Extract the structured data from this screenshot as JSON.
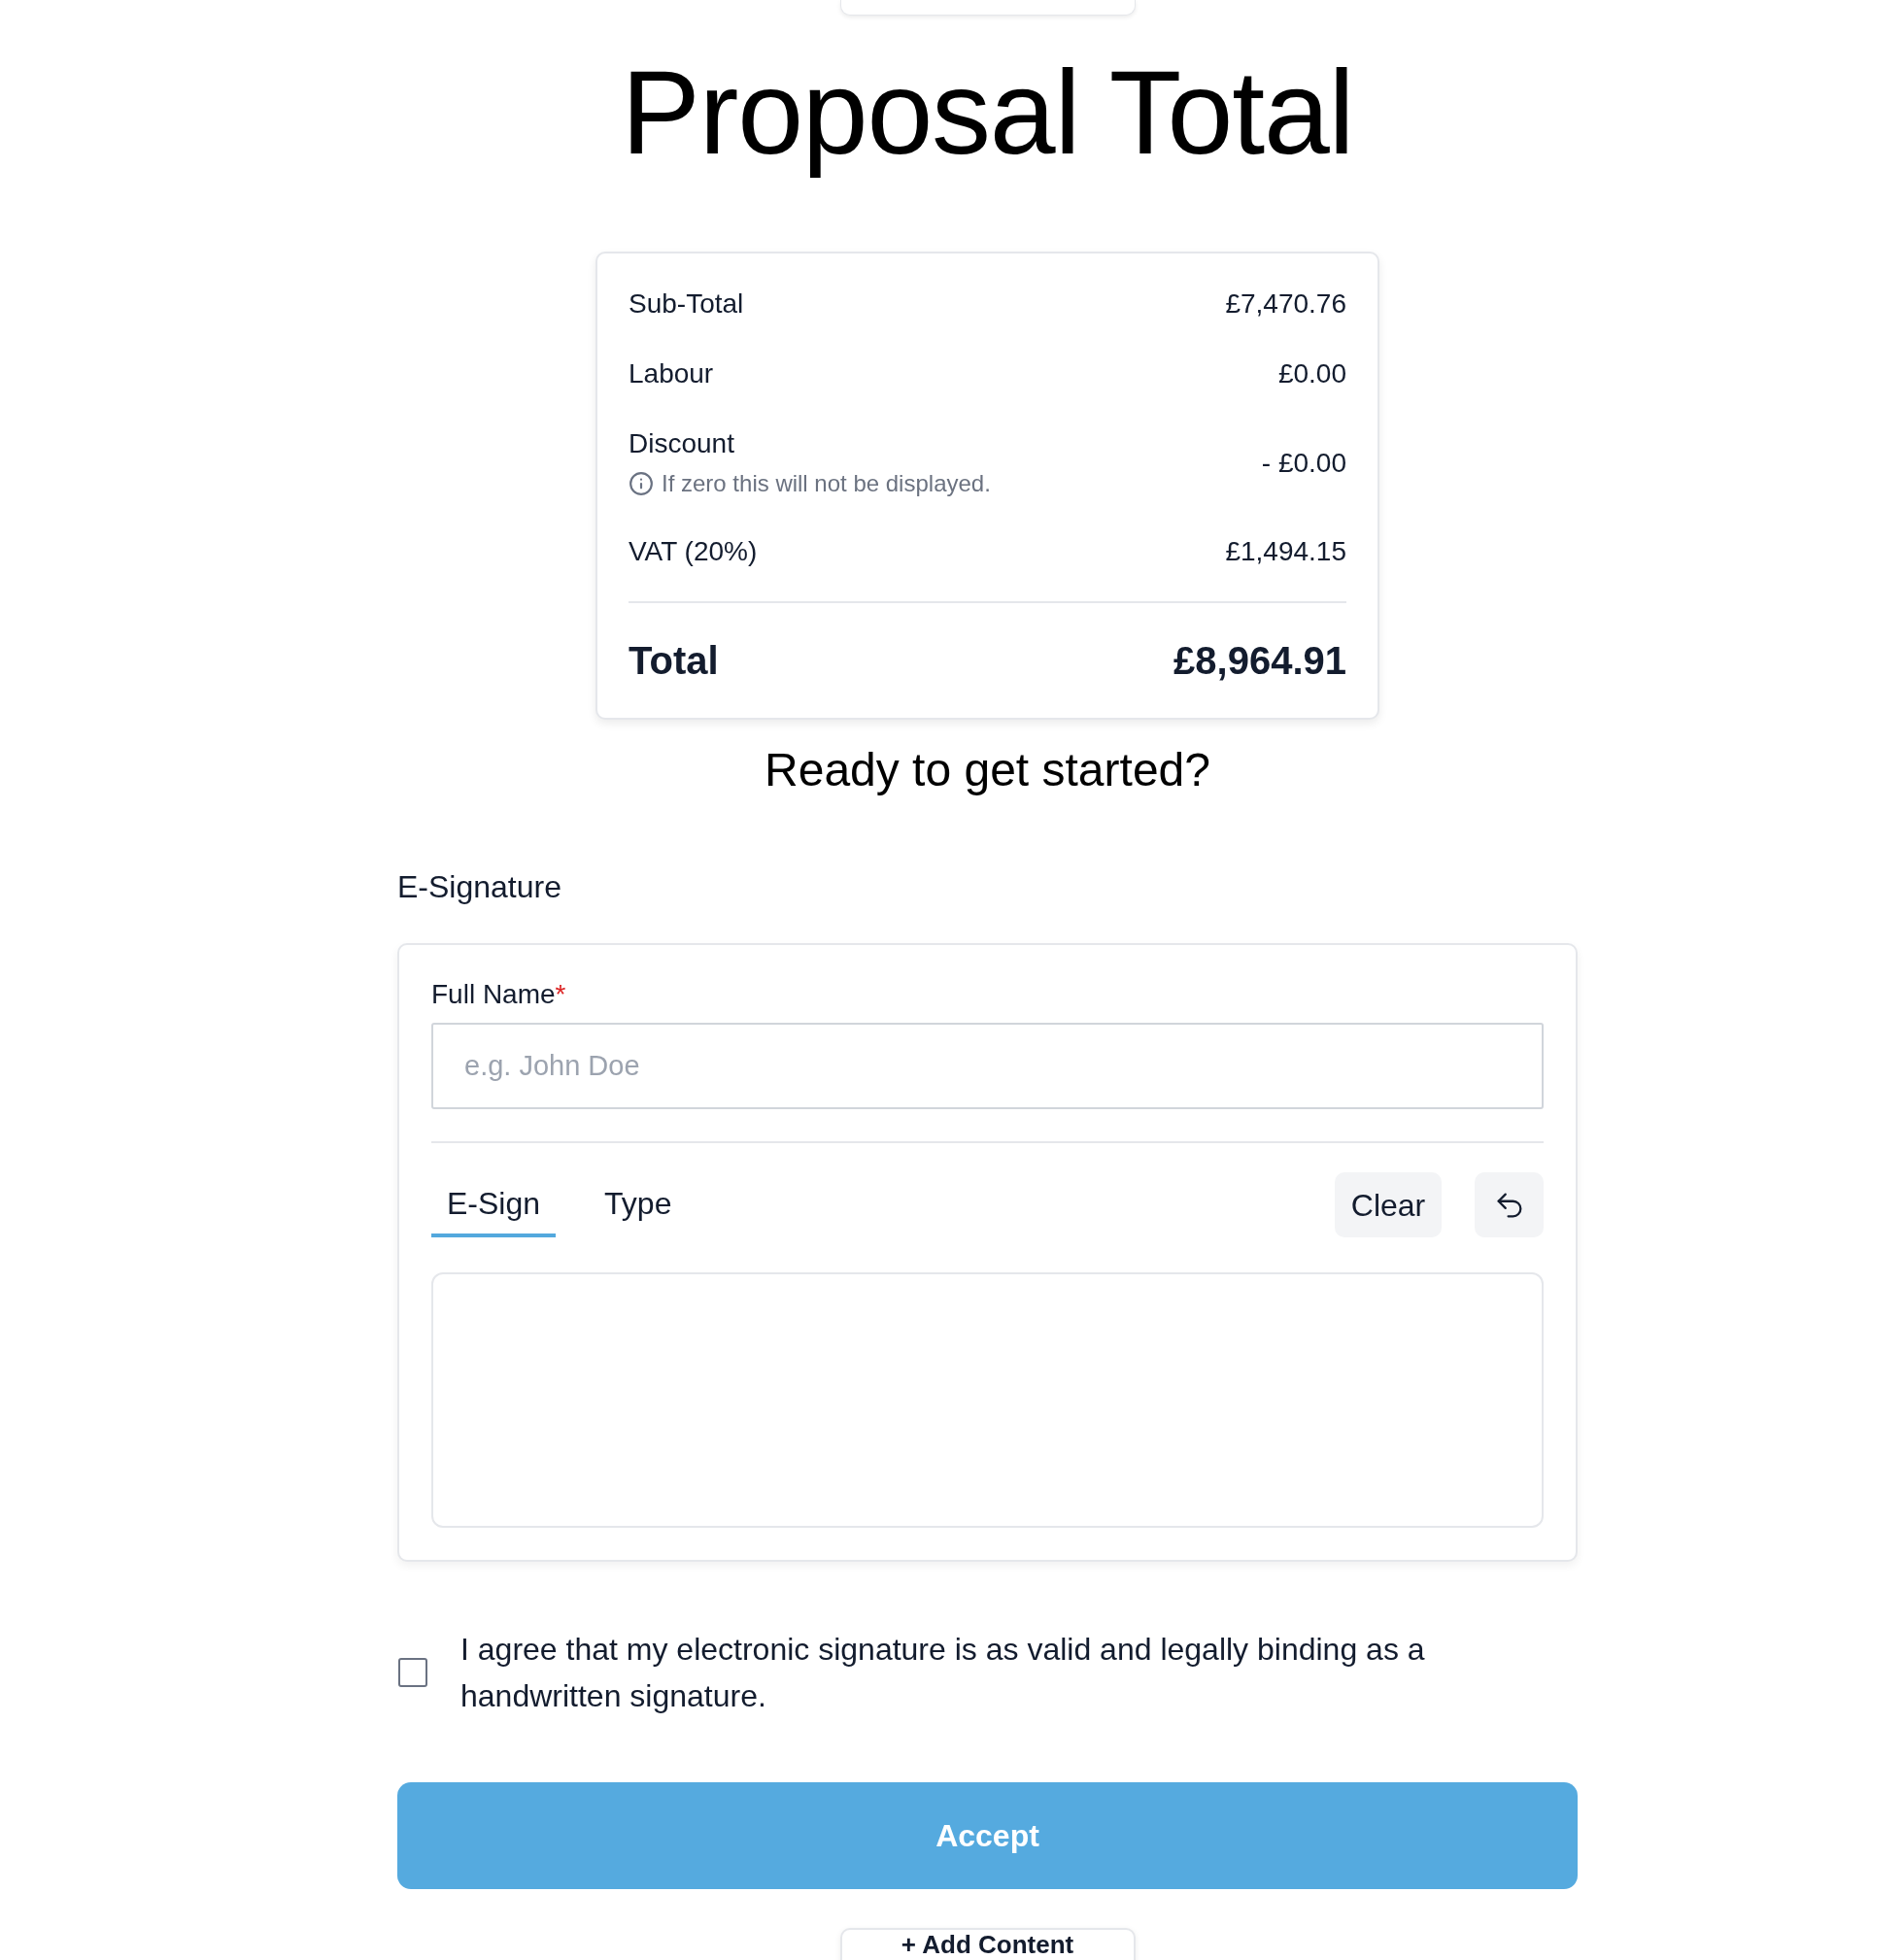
{
  "title": "Proposal Total",
  "summary": {
    "rows": [
      {
        "label": "Sub-Total",
        "value": "£7,470.76"
      },
      {
        "label": "Labour",
        "value": "£0.00"
      },
      {
        "label": "Discount",
        "hint": "If zero this will not be displayed.",
        "value": "- £0.00"
      },
      {
        "label": "VAT (20%)",
        "value": "£1,494.15"
      }
    ],
    "total": {
      "label": "Total",
      "value": "£8,964.91"
    }
  },
  "prompt": "Ready to get started?",
  "signature": {
    "heading": "E-Signature",
    "name_field": {
      "label": "Full Name",
      "required_mark": "*",
      "placeholder": "e.g. John Doe"
    },
    "tabs": [
      {
        "label": "E-Sign",
        "selected": true
      },
      {
        "label": "Type",
        "selected": false
      }
    ],
    "clear_button": "Clear"
  },
  "agreement": {
    "checked": false,
    "text": "I agree that my electronic signature is as valid and legally binding as a handwritten signature."
  },
  "accept_button": "Accept",
  "add_content_button": "+ Add Content"
}
